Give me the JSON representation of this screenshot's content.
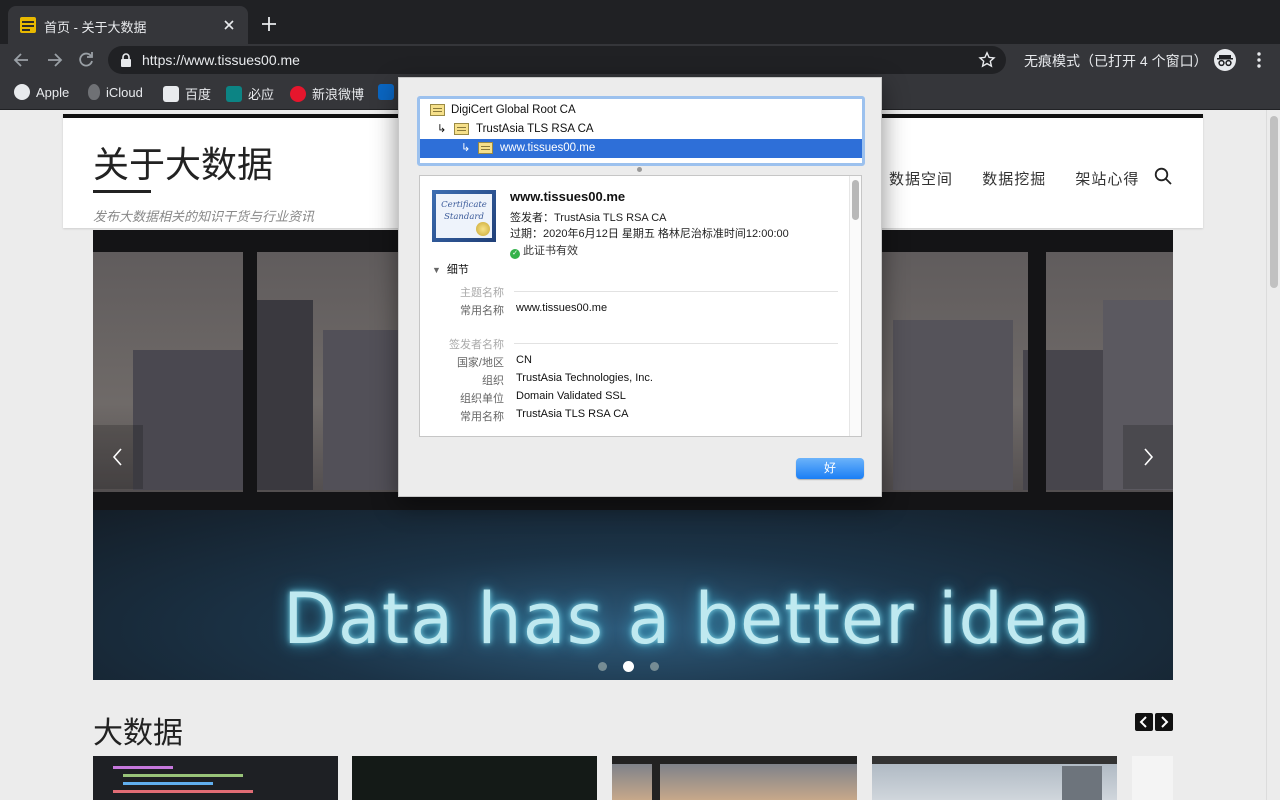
{
  "browser": {
    "tab_title": "首页 - 关于大数据",
    "url_host": "https://www.tissues00.me",
    "incognito_label": "无痕模式（已打开 4 个窗口）",
    "bookmarks": [
      "Apple",
      "iCloud",
      "百度",
      "必应",
      "新浪微博"
    ]
  },
  "site": {
    "title": "关于大数据",
    "description": "发布大数据相关的知识干货与行业资讯",
    "nav": [
      "数据空间",
      "数据挖掘",
      "架站心得"
    ],
    "slide_text": "Data has a better idea",
    "section_title": "大数据"
  },
  "certificate": {
    "chain": [
      "DigiCert Global Root CA",
      "TrustAsia TLS RSA CA",
      "www.tissues00.me"
    ],
    "host": "www.tissues00.me",
    "issuer_line": "签发者：TrustAsia TLS RSA CA",
    "expiry_line": "过期：2020年6月12日 星期五 格林尼治标准时间12:00:00",
    "valid_text": "此证书有效",
    "details_label": "细节",
    "badge_line1": "Certificate",
    "badge_line2": "Standard",
    "subject_heading": "主题名称",
    "subject_cn_label": "常用名称",
    "subject_cn": "www.tissues00.me",
    "issuer_heading": "签发者名称",
    "issuer_fields": [
      {
        "label": "国家/地区",
        "value": "CN"
      },
      {
        "label": "组织",
        "value": "TrustAsia Technologies, Inc."
      },
      {
        "label": "组织单位",
        "value": "Domain Validated SSL"
      },
      {
        "label": "常用名称",
        "value": "TrustAsia TLS RSA CA"
      }
    ],
    "ok_button": "好"
  }
}
